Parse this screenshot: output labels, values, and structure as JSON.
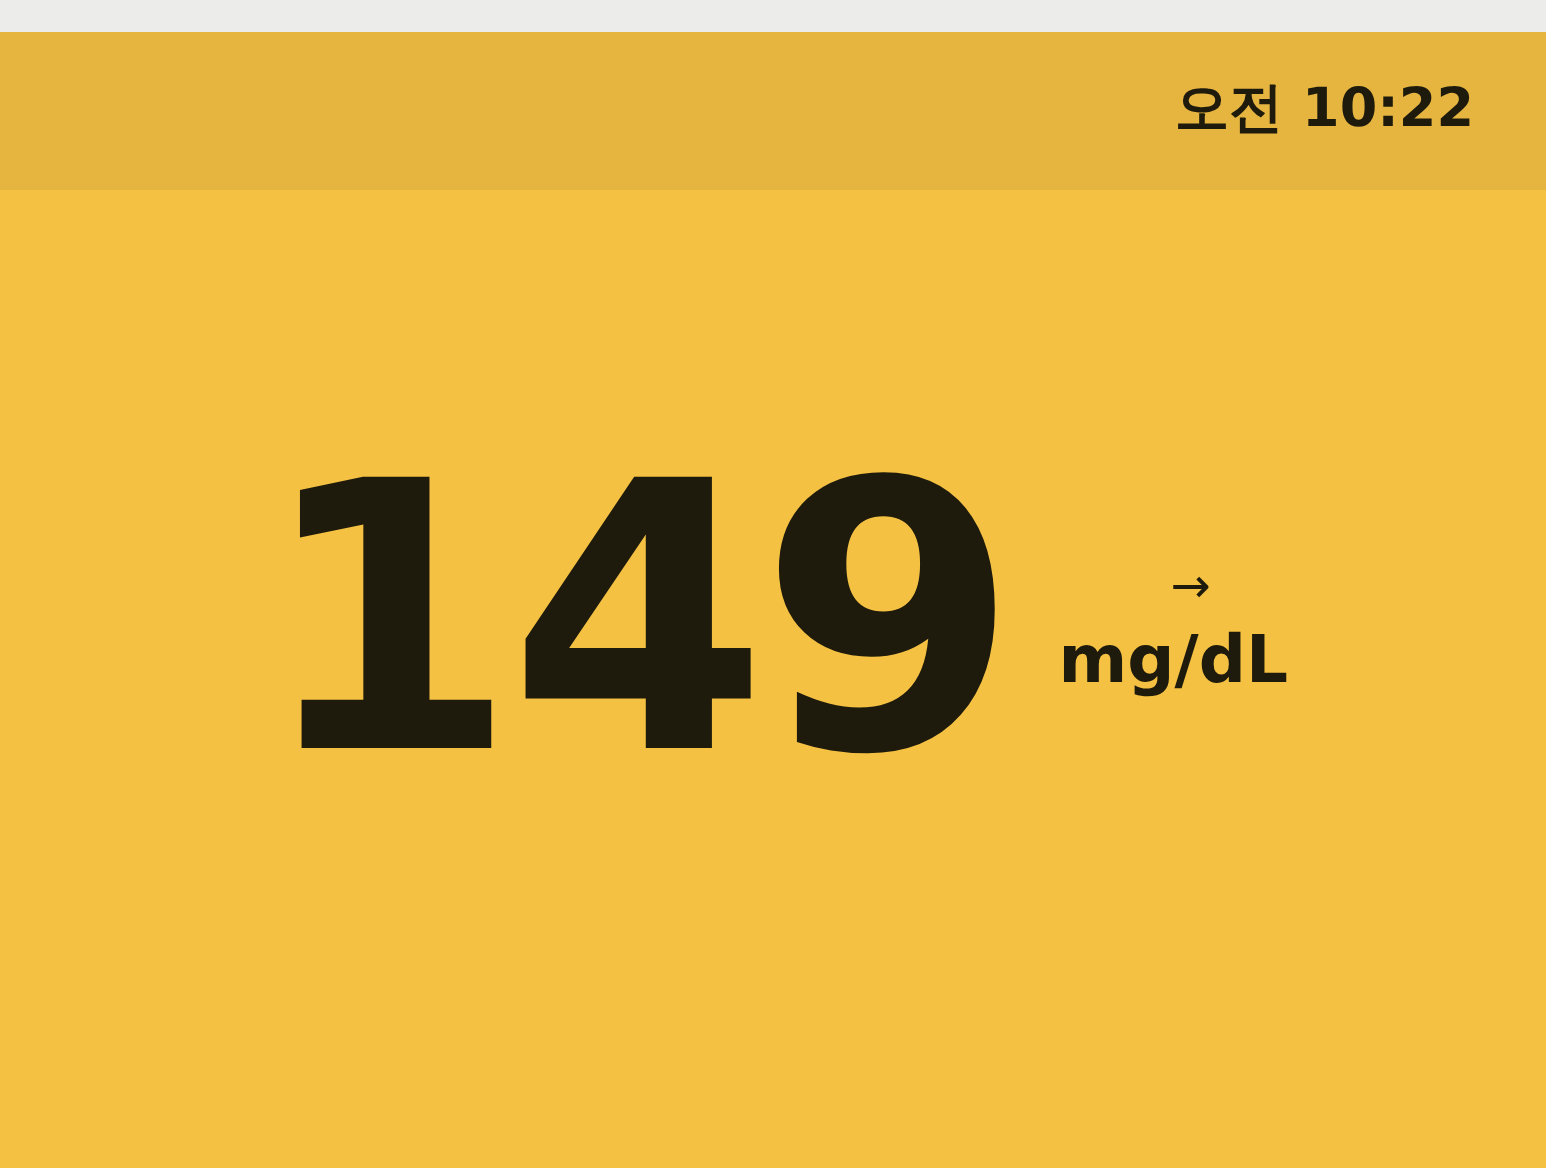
{
  "header": {
    "time": "오전 10:22"
  },
  "reading": {
    "value": "149",
    "trend": "→",
    "unit": "mg/dL"
  }
}
